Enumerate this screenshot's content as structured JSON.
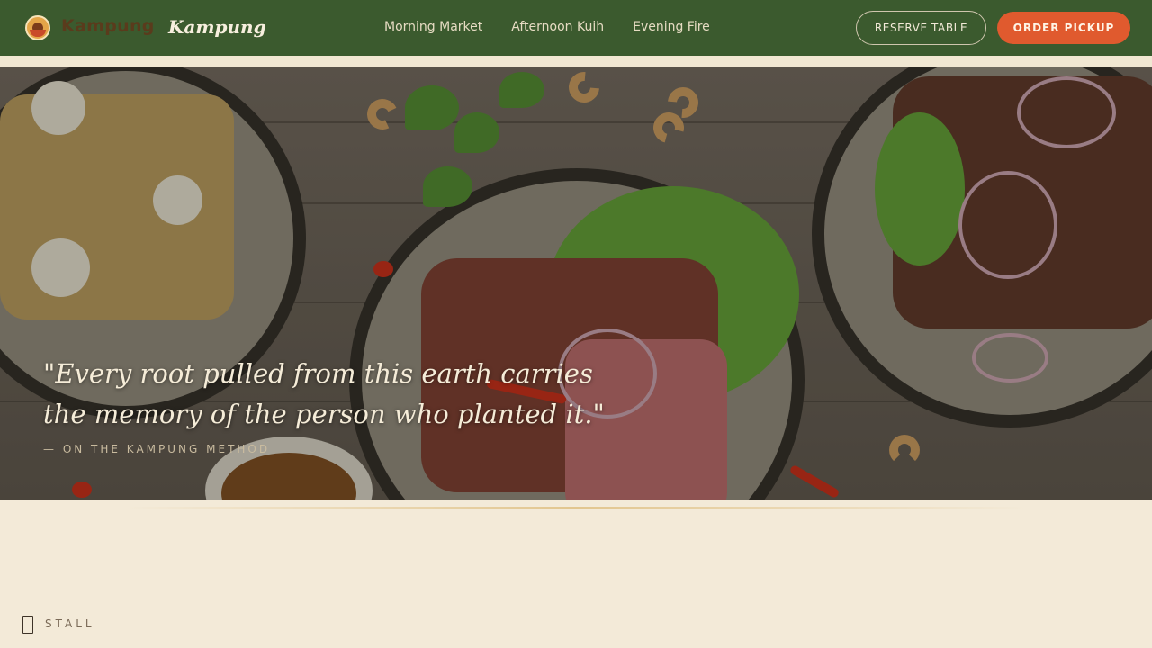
{
  "header": {
    "brand_primary": "Kampung",
    "brand_secondary": "Kampung",
    "nav": [
      "Morning Market",
      "Afternoon Kuih",
      "Evening Fire"
    ],
    "reserve_label": "RESERVE TABLE",
    "order_label": "ORDER PICKUP"
  },
  "hero": {
    "quote": "\"Every root pulled from this earth carries the memory of the person who planted it.\"",
    "attribution": "— ON THE KAMPUNG METHOD"
  },
  "section": {
    "label": "STALL"
  },
  "colors": {
    "header_bg": "#3b5a2e",
    "accent": "#e05a2e",
    "page_bg": "#f3ead8"
  }
}
